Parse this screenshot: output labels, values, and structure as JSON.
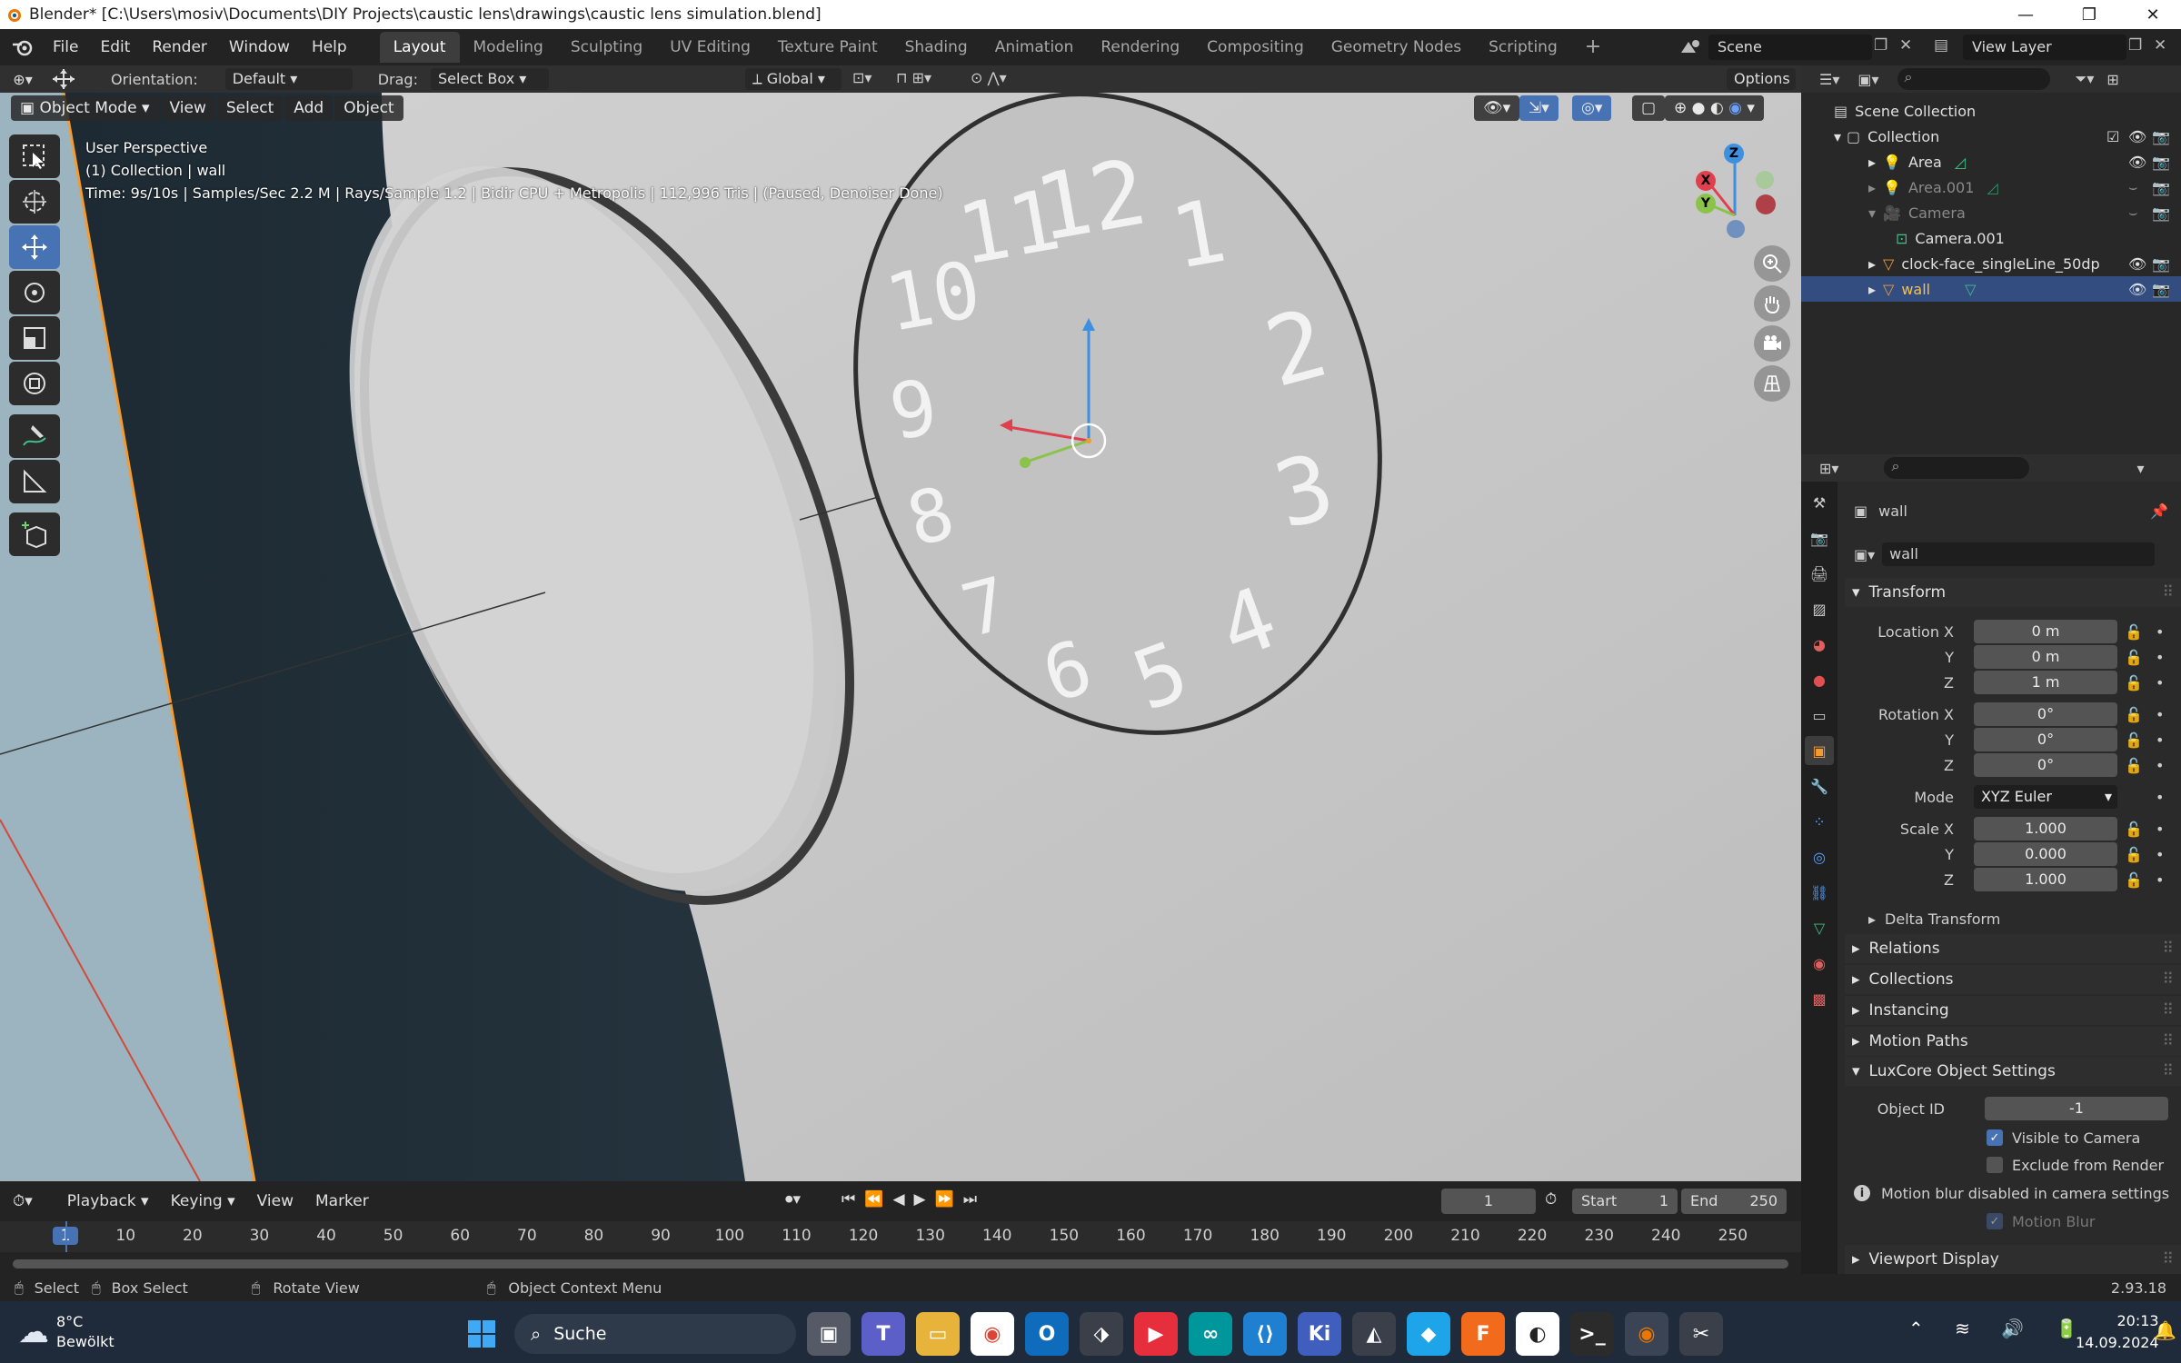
{
  "window": {
    "title": "Blender* [C:\\Users\\mosiv\\Documents\\DIY Projects\\caustic lens\\drawings\\caustic lens simulation.blend]",
    "minimize": "—",
    "maximize": "❐",
    "close": "✕"
  },
  "menu": [
    "File",
    "Edit",
    "Render",
    "Window",
    "Help"
  ],
  "workspaces": [
    "Layout",
    "Modeling",
    "Sculpting",
    "UV Editing",
    "Texture Paint",
    "Shading",
    "Animation",
    "Rendering",
    "Compositing",
    "Geometry Nodes",
    "Scripting"
  ],
  "active_workspace": "Layout",
  "add_workspace": "+",
  "scene": {
    "name": "Scene",
    "view_layer": "View Layer"
  },
  "toolheader": {
    "orientation_label": "Orientation:",
    "orientation_value": "Default",
    "drag_label": "Drag:",
    "drag_value": "Select Box",
    "transform_orientation": "Global",
    "options": "Options"
  },
  "viewport_header": {
    "mode": "Object Mode",
    "menus": [
      "View",
      "Select",
      "Add",
      "Object"
    ]
  },
  "viewport_overlay": {
    "line1": "User Perspective",
    "line2": "(1) Collection | wall",
    "line3": "Time: 9s/10s | Samples/Sec 2.2 M | Rays/Sample 1.2 | Bidir CPU + Metropolis | 112,996 Tris | (Paused, Denoiser Done)"
  },
  "gizmo": {
    "x": "X",
    "y": "Y",
    "z": "Z"
  },
  "clock_digits": [
    "12",
    "1",
    "2",
    "3",
    "4",
    "5",
    "6",
    "7",
    "8",
    "9",
    "10",
    "11"
  ],
  "outliner": {
    "root": "Scene Collection",
    "collection": "Collection",
    "items": [
      {
        "name": "Area",
        "icon": "light-icon"
      },
      {
        "name": "Area.001",
        "icon": "light-icon"
      },
      {
        "name": "Camera",
        "icon": "camera-icon"
      },
      {
        "name": "Camera.001",
        "icon": "camera-data-icon"
      },
      {
        "name": "clock-face_singleLine_50dp",
        "icon": "mesh-icon"
      },
      {
        "name": "wall",
        "icon": "mesh-icon"
      }
    ]
  },
  "properties": {
    "object_name": "wall",
    "data_name": "wall",
    "transform_header": "Transform",
    "location_label": "Location X",
    "location": [
      "0 m",
      "0 m",
      "1 m"
    ],
    "rotation_label": "Rotation X",
    "rotation": [
      "0°",
      "0°",
      "0°"
    ],
    "mode_label": "Mode",
    "mode_value": "XYZ Euler",
    "scale_label": "Scale X",
    "scale": [
      "1.000",
      "0.000",
      "1.000"
    ],
    "axis_y": "Y",
    "axis_z": "Z",
    "delta": "Delta Transform",
    "sections": [
      "Relations",
      "Collections",
      "Instancing",
      "Motion Paths"
    ],
    "luxcore_header": "LuxCore Object Settings",
    "object_id_label": "Object ID",
    "object_id": "-1",
    "visible_to_camera": "Visible to Camera",
    "exclude_from_render": "Exclude from Render",
    "motion_blur_info": "Motion blur disabled in camera settings",
    "motion_blur": "Motion Blur",
    "viewport_display": "Viewport Display"
  },
  "timeline": {
    "menus": [
      "Playback",
      "Keying",
      "View",
      "Marker"
    ],
    "current_frame": "1",
    "start_label": "Start",
    "start": "1",
    "end_label": "End",
    "end": "250",
    "ruler": [
      "1",
      "10",
      "20",
      "30",
      "40",
      "50",
      "60",
      "70",
      "80",
      "90",
      "100",
      "110",
      "120",
      "130",
      "140",
      "150",
      "160",
      "170",
      "180",
      "190",
      "200",
      "210",
      "220",
      "230",
      "240",
      "250"
    ]
  },
  "statusbar": {
    "select": "Select",
    "box_select": "Box Select",
    "rotate_view": "Rotate View",
    "context_menu": "Object Context Menu",
    "version": "2.93.18"
  },
  "taskbar": {
    "temp": "8°C",
    "weather": "Bewölkt",
    "search": "Suche",
    "time": "20:13",
    "date": "14.09.2024"
  },
  "colors": {
    "accent": "#4772b3",
    "selected_row": "#334d80",
    "x_axis": "#e0404e",
    "y_axis": "#8bc34a",
    "z_axis": "#3d8fe0",
    "viewport_bg": "#c6c6c6"
  }
}
